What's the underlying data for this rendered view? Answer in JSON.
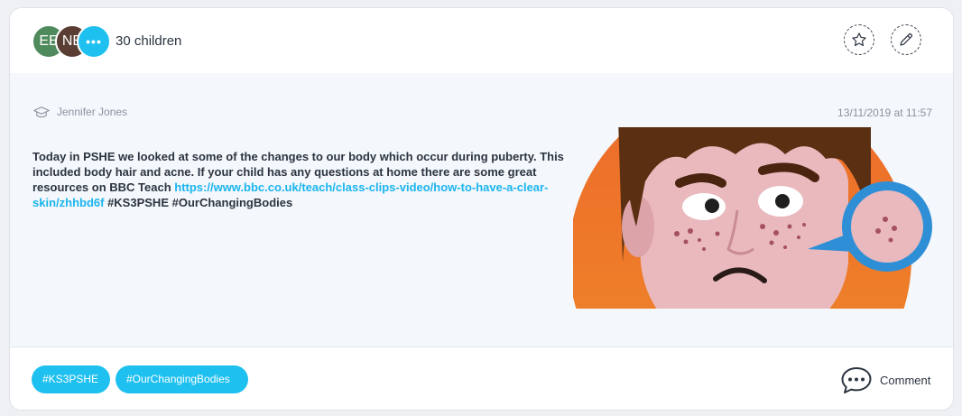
{
  "header": {
    "avatars": [
      {
        "initials": "EE"
      },
      {
        "initials": "NB"
      },
      {
        "initials": "•••"
      }
    ],
    "children_count": "30 children",
    "star_icon": "star-icon",
    "edit_icon": "pencil-icon"
  },
  "post": {
    "author": "Jennifer Jones",
    "author_icon": "graduation-cap-icon",
    "timestamp": "13/11/2019 at 11:57",
    "text_intro": "Today in PSHE we looked at some of the changes to our body which occur during puberty. This included body hair and acne. If your child has any questions at home there are some great resources on BBC Teach ",
    "link": "https://www.bbc.co.uk/teach/class-clips-video/how-to-have-a-clear-skin/zhhbd6f",
    "hashtags_text": " #KS3PSHE  #OurChangingBodies"
  },
  "footer": {
    "tags": [
      "#KS3PSHE",
      "#OurChangingBodies"
    ],
    "comment_label": "Comment",
    "comment_icon": "speech-bubble-icon"
  },
  "colors": {
    "accent": "#1ec0f0",
    "text": "#2b3440",
    "muted": "#8a93a0"
  }
}
